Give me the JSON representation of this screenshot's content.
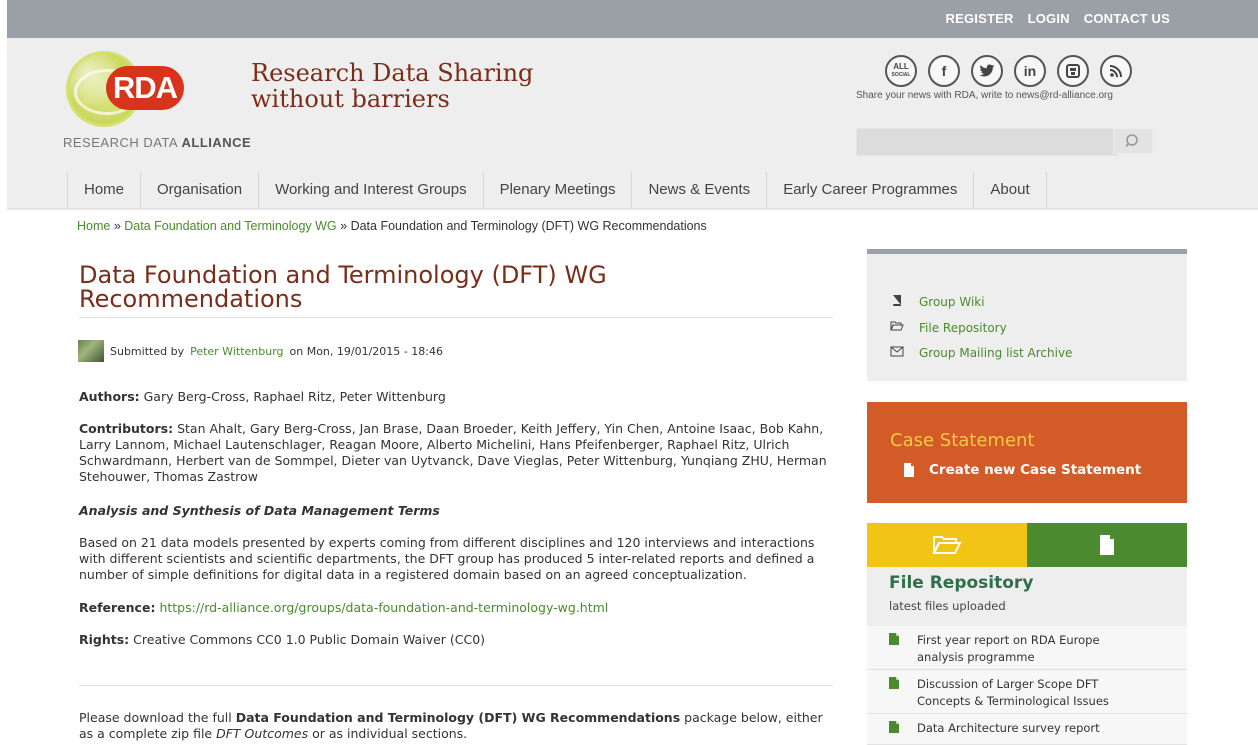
{
  "topbar": {
    "register": "REGISTER",
    "login": "LOGIN",
    "contact": "CONTACT US"
  },
  "brand": {
    "logo_text": "RDA",
    "logo_sub_light": "RESEARCH DATA",
    "logo_sub_bold": "ALLIANCE",
    "tagline_line1": "Research Data Sharing",
    "tagline_line2": "without barriers"
  },
  "social": {
    "all_social_line1": "ALL",
    "all_social_line2": "SOCIAL",
    "facebook": "f",
    "twitter": "t",
    "linkedin": "in",
    "share_note": "Share your news with RDA, write to news@rd-alliance.org"
  },
  "search": {
    "placeholder": ""
  },
  "nav": {
    "items": [
      "Home",
      "Organisation",
      "Working and Interest Groups",
      "Plenary Meetings",
      "News & Events",
      "Early Career Programmes",
      "About"
    ]
  },
  "breadcrumb": {
    "home": "Home",
    "sep": "»",
    "group": "Data Foundation and Terminology WG",
    "current": "Data Foundation and Terminology (DFT) WG Recommendations"
  },
  "page": {
    "title": "Data Foundation and Terminology (DFT) WG Recommendations",
    "submitted_prefix": "Submitted by",
    "submitted_author": "Peter Wittenburg",
    "submitted_date": "on Mon, 19/01/2015 - 18:46",
    "authors_label": "Authors:",
    "authors": "Gary Berg-Cross, Raphael Ritz, Peter Wittenburg",
    "contributors_label": "Contributors:",
    "contributors": "Stan Ahalt, Gary Berg-Cross, Jan Brase, Daan Broeder, Keith Jeffery, Yin Chen, Antoine Isaac, Bob Kahn, Larry Lannom, Michael Lautenschlager, Reagan Moore, Alberto Michelini, Hans Pfeifenberger, Raphael Ritz, Ulrich Schwardmann, Herbert van de Sommpel, Dieter van Uytvanck, Dave Vieglas, Peter Wittenburg, Yunqiang ZHU, Herman Stehouwer, Thomas Zastrow",
    "section_heading": "Analysis and Synthesis of Data Management Terms",
    "body": "Based on 21 data models presented by experts coming from different disciplines and 120 interviews and interactions with different scientists and scientific departments, the DFT group has produced 5 inter-related reports and defined a number of simple definitions for digital data in a registered domain based on an agreed conceptualization.",
    "reference_label": "Reference:",
    "reference_url": "https://rd-alliance.org/groups/data-foundation-and-terminology-wg.html",
    "rights_label": "Rights:",
    "rights": "Creative Commons CC0 1.0 Public Domain Waiver (CC0)",
    "download_pre": "Please download the full",
    "download_bold": "Data Foundation and Terminology (DFT) WG Recommendations",
    "download_mid": "package below, either as a complete zip file",
    "download_italic": "DFT Outcomes",
    "download_post": "or as individual sections."
  },
  "sidebar": {
    "links": [
      {
        "label": "Group Wiki",
        "icon": "book-icon"
      },
      {
        "label": "File Repository",
        "icon": "folder-open-icon"
      },
      {
        "label": "Group Mailing list Archive",
        "icon": "envelope-icon"
      }
    ],
    "case": {
      "title": "Case Statement",
      "link": "Create new Case Statement"
    },
    "repo": {
      "title": "File Repository",
      "subtitle": "latest files uploaded",
      "files": [
        "First year report on RDA Europe analysis programme",
        "Discussion of Larger Scope DFT Concepts & Terminological Issues",
        "Data Architecture survey report"
      ]
    }
  },
  "colors": {
    "topbar": "#9aa0a5",
    "brand_red": "#d8341b",
    "title_brown": "#7a2e1a",
    "link_green": "#4b8a2e",
    "case_orange": "#d35b27",
    "case_title_yellow": "#f6c84a",
    "tab_yellow": "#f2c416",
    "tab_green": "#4b8a2e",
    "repo_title": "#2f6f4b"
  }
}
